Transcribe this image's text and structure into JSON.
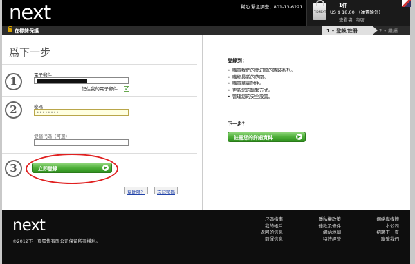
{
  "header": {
    "logo": "next",
    "help": "幫助 緊急調查：801-13-6221",
    "cart": {
      "bag_label": "TIDNEXT",
      "count": "1件",
      "total": "US $ 18.00 （運費除外）",
      "link": "查看袋: 商店"
    }
  },
  "secure_bar": {
    "label": "在標誌保護",
    "step1": "1 • 登錄/註冊",
    "step2": "2 • 繼續"
  },
  "left": {
    "title": "爲下一步",
    "step_numbers": [
      "1",
      "2",
      "3"
    ],
    "email_label": "電子郵件",
    "remember_label": "記住我的電子郵件",
    "remember_checked": true,
    "password_label": "密碼",
    "password_value": "••••••••",
    "promo_label": "促銷代碼（可選）",
    "login_button": "立即登錄",
    "help_button": "幫助嗎？",
    "forgot_button": "忘記密碼"
  },
  "right": {
    "title": "登錄到：",
    "benefits": [
      "購買我們的夢幻般的時裝系列。",
      "購物最新的范圍。",
      "購買華麗附件。",
      "更新您的聯繫方式。",
      "管理您的安全設置。"
    ],
    "next_title": "下一步？",
    "register_button": "註冊您的詳細資料"
  },
  "footer": {
    "logo": "next",
    "copyright": "©2012下一頁零售有限公司保留所有權利。",
    "col1": [
      "尺碼指南",
      "我的帳戶",
      "返回的信息",
      "前運信息"
    ],
    "col2": [
      "隱私權政策",
      "條款及條件",
      "網站地圖",
      "特許經營"
    ],
    "col3": [
      "網絡與媒體",
      "本公司",
      "招聘下一頁",
      "聯繫我們"
    ]
  }
}
